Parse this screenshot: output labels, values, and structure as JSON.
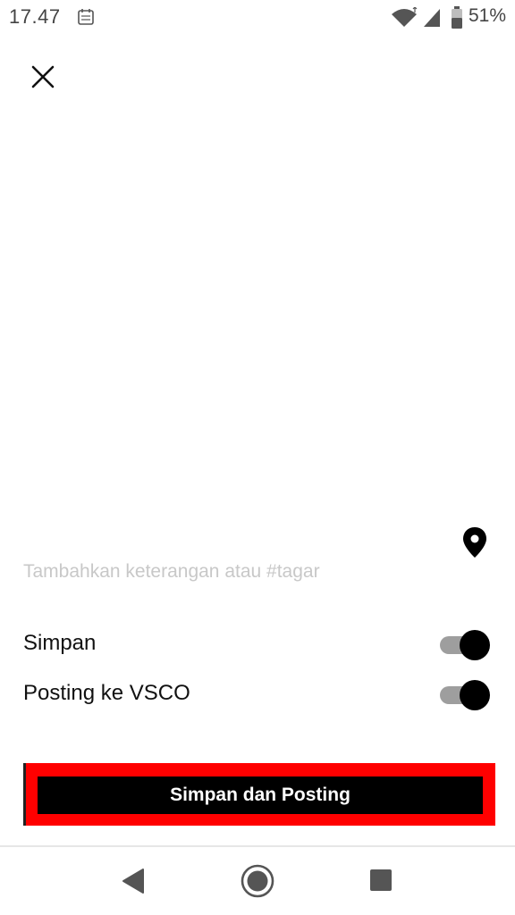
{
  "status_bar": {
    "time": "17.47",
    "battery_percent": "51%",
    "battery_level": 0.51,
    "notification_icon": "calendar-notification-icon",
    "wifi_icon": "wifi-icon",
    "signal_icon": "cell-signal-icon",
    "battery_icon": "battery-icon"
  },
  "header": {
    "close_icon": "close-icon"
  },
  "caption": {
    "placeholder": "Tambahkan keterangan atau #tagar",
    "value": "",
    "location_icon": "location-pin-icon"
  },
  "toggles": [
    {
      "label": "Simpan",
      "on": true
    },
    {
      "label": "Posting ke VSCO",
      "on": true
    }
  ],
  "primary_button": {
    "label": "Simpan dan Posting",
    "highlight_color": "#ff0000",
    "background_color": "#000000"
  },
  "nav_bar": {
    "back_icon": "back-triangle-icon",
    "home_icon": "home-circle-icon",
    "recents_icon": "recents-square-icon"
  }
}
